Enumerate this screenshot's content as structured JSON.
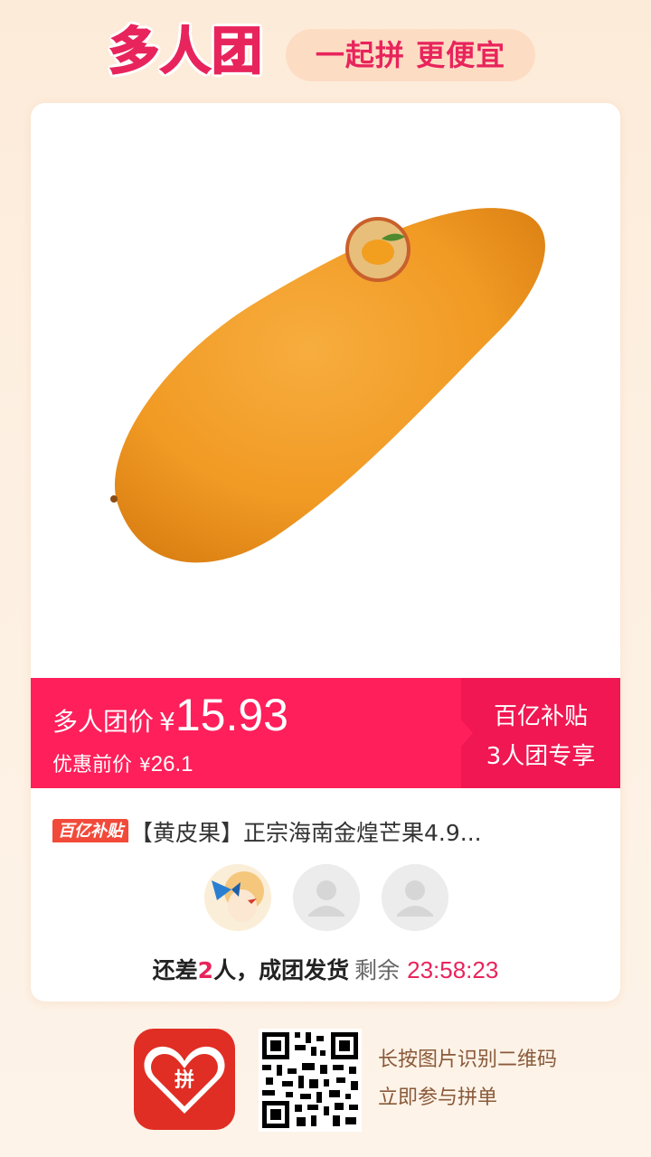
{
  "header": {
    "logo": "多人团",
    "slogan": "一起拼 更便宜"
  },
  "product": {
    "image_icon": "mango-image",
    "group_price_label": "多人团价",
    "currency": "¥",
    "group_price": "15.93",
    "original_price_label": "优惠前价",
    "original_price": "26.1",
    "subsidy_line1": "百亿补贴",
    "subsidy_line2": "3人团专享",
    "badge": "百亿补贴",
    "title": "【黄皮果】正宗海南金煌芒果4.9..."
  },
  "group": {
    "members": [
      {
        "icon": "member-avatar"
      },
      {
        "icon": "empty-person-icon"
      },
      {
        "icon": "empty-person-icon"
      }
    ],
    "status_prefix": "还差",
    "missing_count": "2",
    "status_suffix": "人，成团发货",
    "remaining_label": "剩余",
    "countdown": "23:58:23"
  },
  "footer": {
    "app_icon": "pinduoduo-app-icon",
    "qr_icon": "qr-code-icon",
    "line1": "长按图片识别二维码",
    "line2": "立即参与拼单"
  },
  "colors": {
    "accent": "#ff1f5a",
    "brand_red": "#e02e24",
    "background": "#fdebd9"
  }
}
